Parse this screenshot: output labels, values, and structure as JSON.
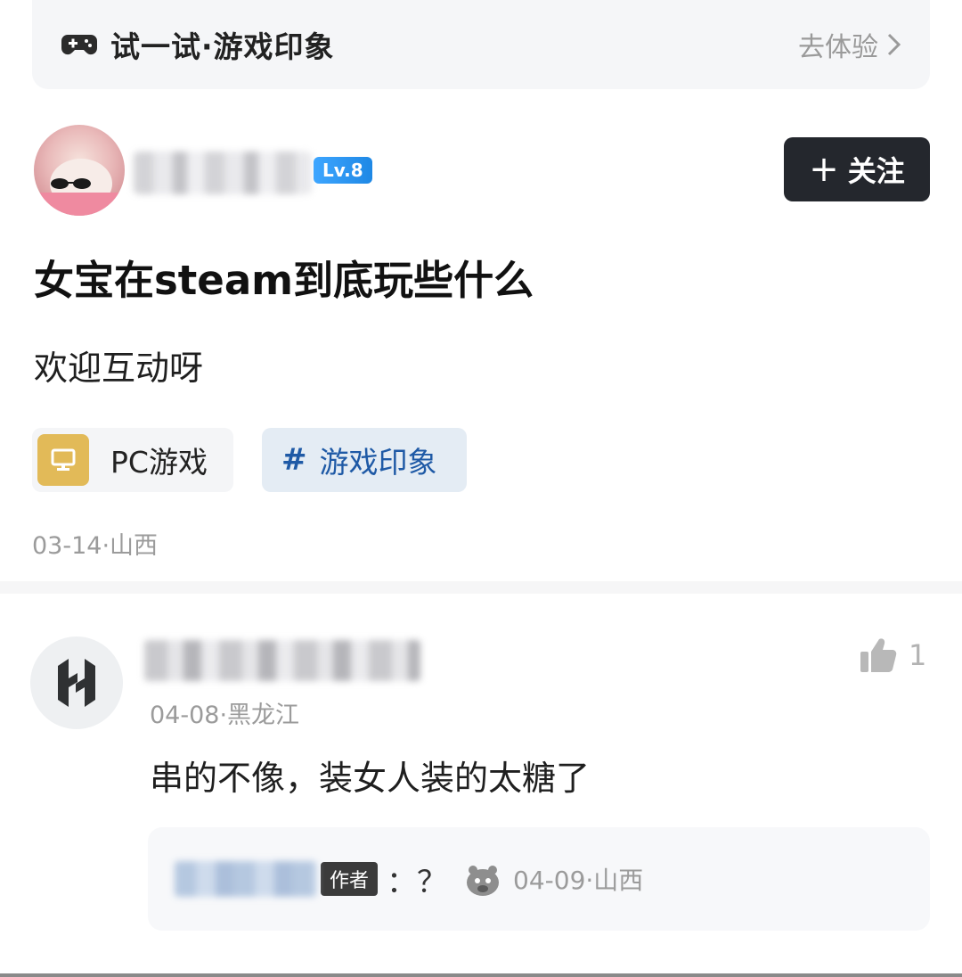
{
  "banner": {
    "title": "试一试·游戏印象",
    "action_label": "去体验",
    "gamepad_icon": "gamepad-icon",
    "chevron_icon": "chevron-right-icon"
  },
  "author": {
    "level": "Lv.8",
    "follow_label": "关注"
  },
  "post": {
    "title": "女宝在steam到底玩些什么",
    "body": "欢迎互动呀",
    "tags": [
      {
        "label": "PC游戏",
        "icon": "monitor-icon",
        "color": "#e2ba58"
      },
      {
        "label": "游戏印象",
        "icon": "hash-icon",
        "color": "#1f5aa6"
      }
    ],
    "meta": "03-14·山西"
  },
  "comment": {
    "meta": "04-08·黑龙江",
    "text": "串的不像，装女人装的太糖了",
    "likes": "1",
    "reply": {
      "badge": "作者",
      "text": "：？",
      "meta": "04-09·山西"
    }
  },
  "colors": {
    "follow_button": "#24272d",
    "level_badge": "#1e88e5",
    "topic_tag_bg": "#e4ecf4"
  }
}
